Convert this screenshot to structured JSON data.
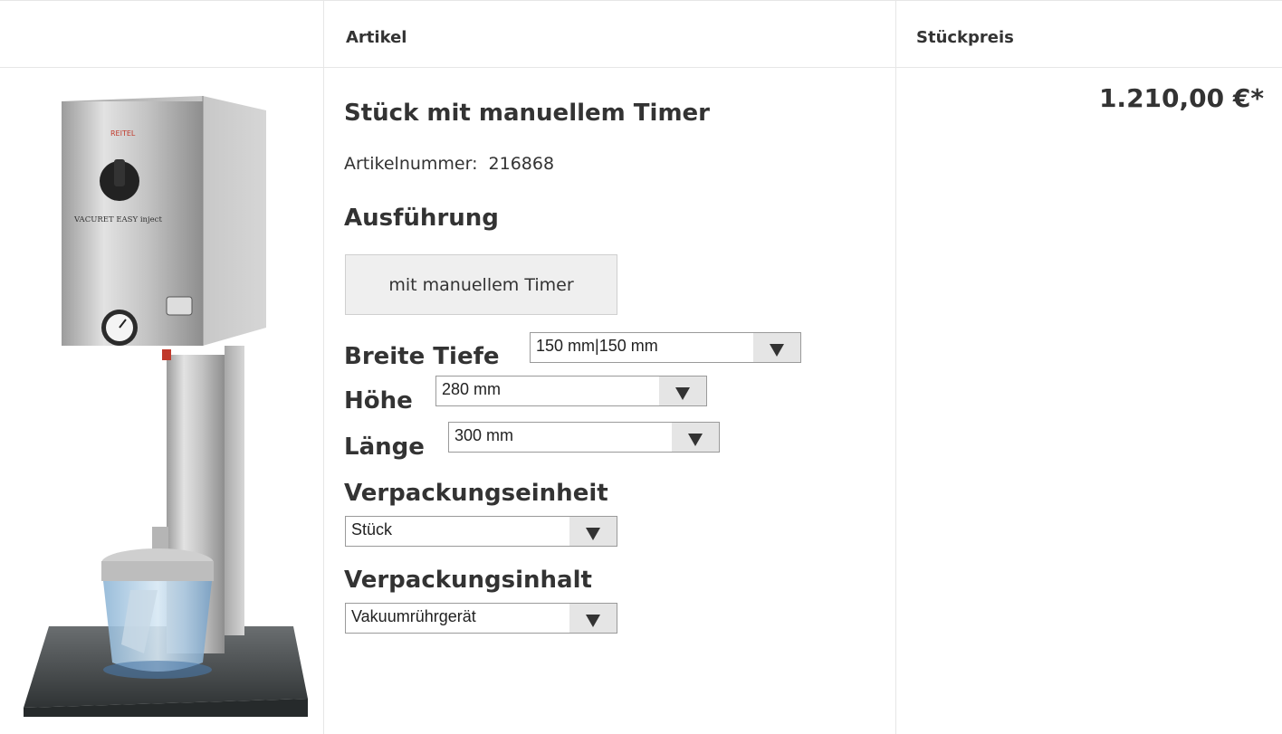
{
  "header": {
    "col_article": "Artikel",
    "col_price": "Stückpreis"
  },
  "product": {
    "title": "Stück mit manuellem Timer",
    "article_number_label": "Artikelnummer:",
    "article_number": "216868",
    "image_label": "VACURET EASY inject",
    "image_brand": "REITEL"
  },
  "sections": {
    "ausfuehrung": "Ausführung",
    "breite_tiefe": "Breite Tiefe",
    "hoehe": "Höhe",
    "laenge": "Länge",
    "verpackungseinheit": "Verpackungseinheit",
    "verpackungsinhalt": "Verpackungsinhalt"
  },
  "options": {
    "ausfuehrung_button": "mit manuellem Timer",
    "breite_tiefe_value": "150 mm|150 mm",
    "hoehe_value": "280 mm",
    "laenge_value": "300 mm",
    "verpackungseinheit_value": "Stück",
    "verpackungsinhalt_value": "Vakuumrührgerät"
  },
  "price": {
    "value": "1.210,00 €*"
  }
}
